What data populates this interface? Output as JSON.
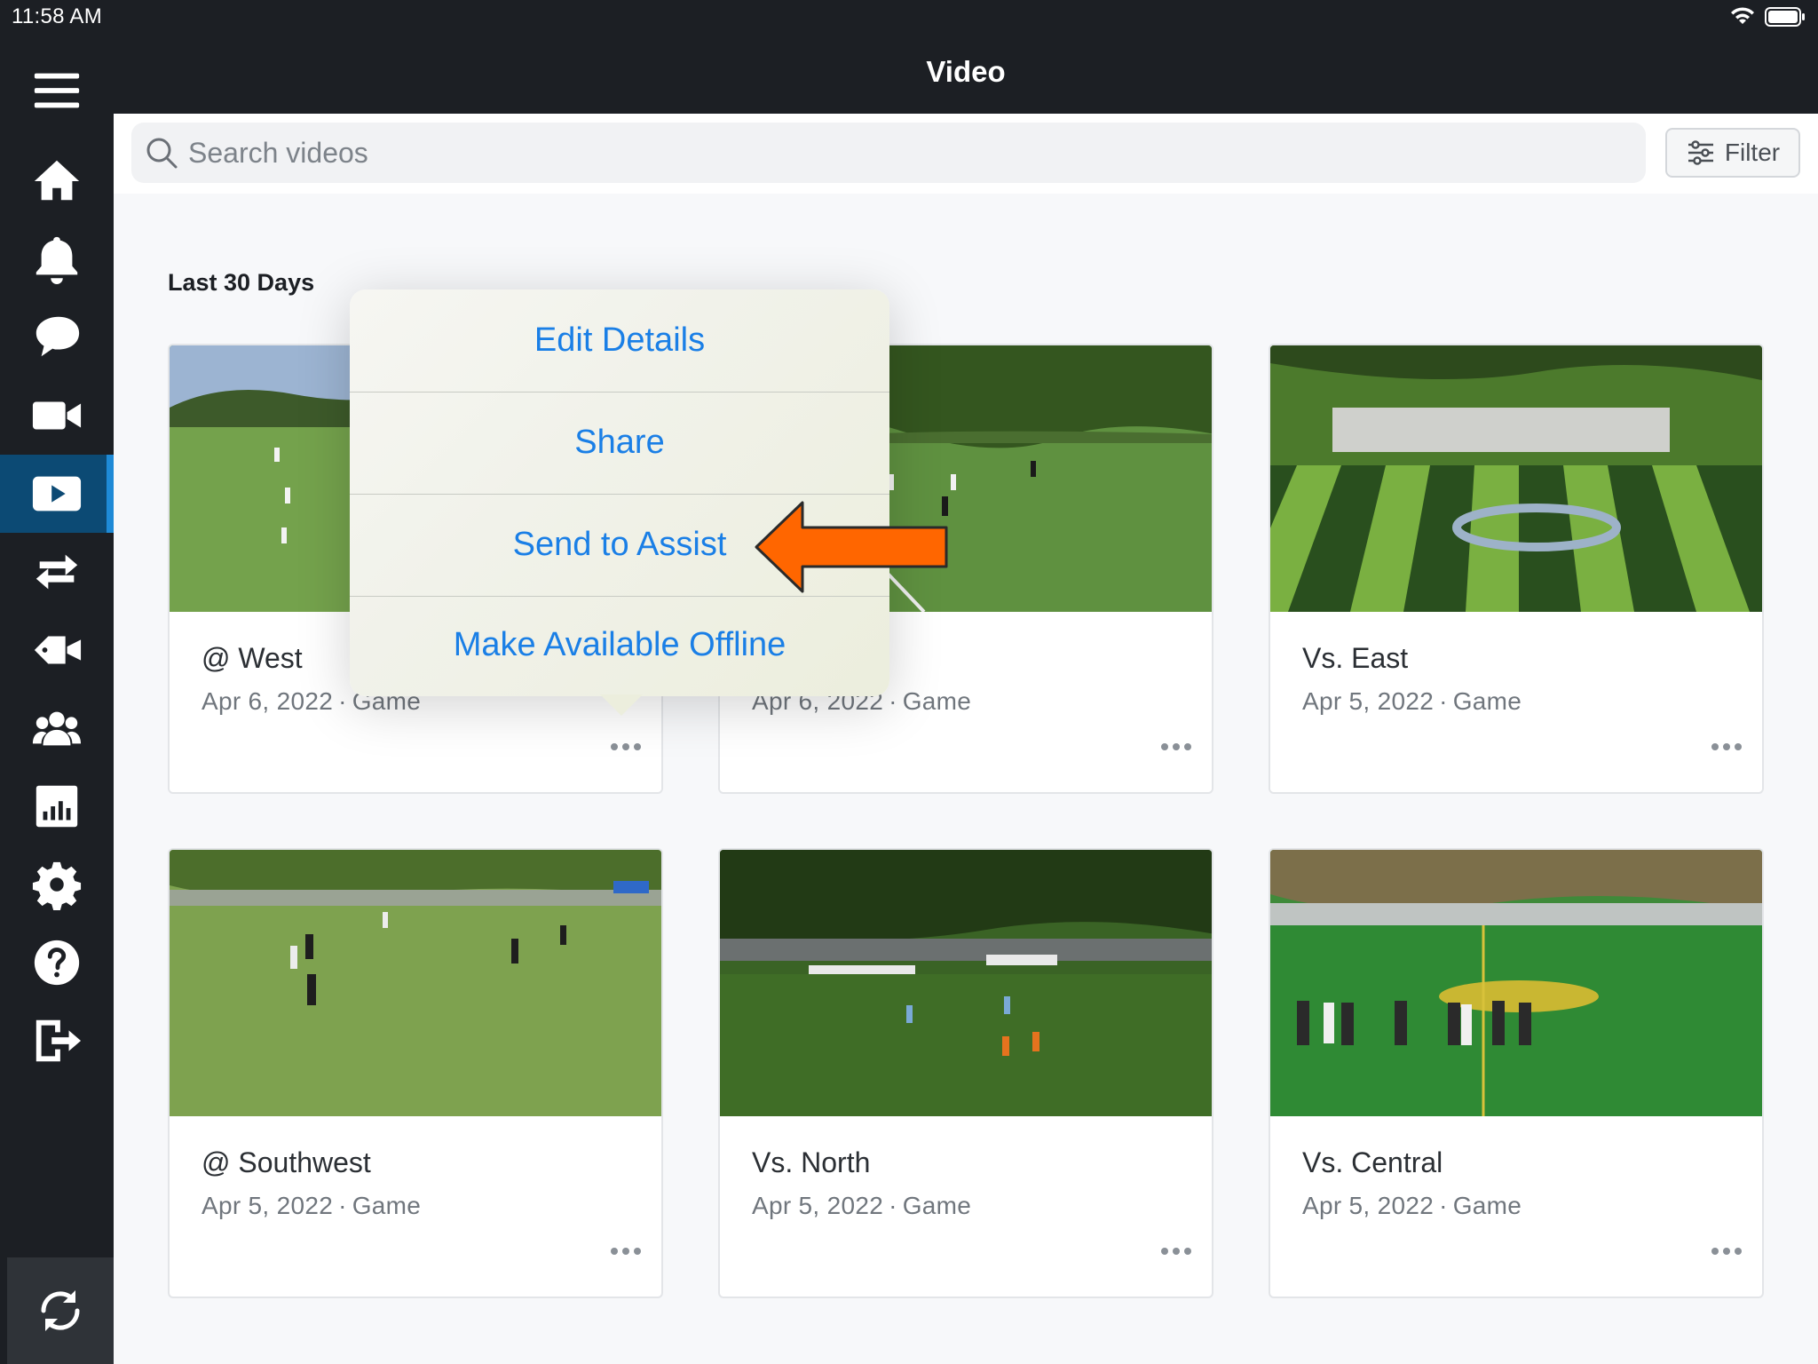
{
  "status": {
    "time": "11:58 AM"
  },
  "header": {
    "title": "Video"
  },
  "search": {
    "placeholder": "Search videos",
    "filter_label": "Filter"
  },
  "sidebar": {
    "items": [
      {
        "icon": "menu-icon"
      },
      {
        "icon": "home-icon"
      },
      {
        "icon": "bell-icon"
      },
      {
        "icon": "chat-icon"
      },
      {
        "icon": "video-camera-icon"
      },
      {
        "icon": "play-video-icon",
        "active": true
      },
      {
        "icon": "exchange-icon"
      },
      {
        "icon": "tag-camera-icon"
      },
      {
        "icon": "team-icon"
      },
      {
        "icon": "stats-icon"
      },
      {
        "icon": "gear-icon"
      },
      {
        "icon": "help-icon"
      },
      {
        "icon": "logout-icon"
      },
      {
        "icon": "sync-icon"
      }
    ]
  },
  "section": {
    "title": "Last 30 Days"
  },
  "videos": [
    {
      "title": "@ West",
      "date": "Apr 6, 2022",
      "type": "Game"
    },
    {
      "title": "",
      "date": "Apr 6, 2022",
      "type": "Game"
    },
    {
      "title": "Vs. East",
      "date": "Apr 5, 2022",
      "type": "Game"
    },
    {
      "title": "@ Southwest",
      "date": "Apr 5, 2022",
      "type": "Game"
    },
    {
      "title": "Vs. North",
      "date": "Apr 5, 2022",
      "type": "Game"
    },
    {
      "title": "Vs. Central",
      "date": "Apr 5, 2022",
      "type": "Game"
    }
  ],
  "popover": {
    "items": [
      "Edit Details",
      "Share",
      "Send to Assist",
      "Make Available Offline"
    ]
  },
  "colors": {
    "accent": "#1a7fe6",
    "sidebar": "#1c1f24",
    "active": "#0c4a74",
    "arrow": "#ff6600"
  }
}
